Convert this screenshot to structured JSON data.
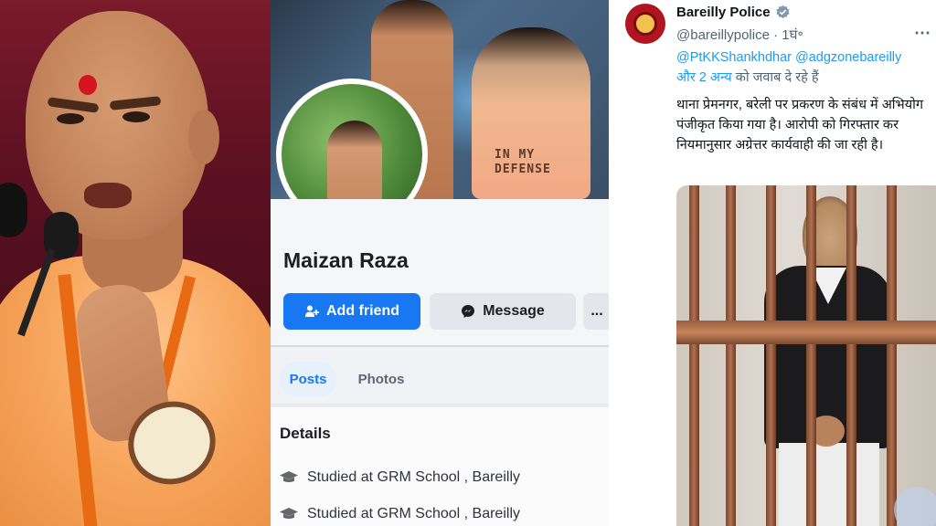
{
  "facebook": {
    "profile_name": "Maizan Raza",
    "cover_shirt_text": "IN MY DEFENSE",
    "add_friend_label": "Add friend",
    "message_label": "Message",
    "more_label": "...",
    "tabs": [
      {
        "label": "Posts",
        "active": true
      },
      {
        "label": "Photos",
        "active": false
      }
    ],
    "details_title": "Details",
    "details": [
      {
        "icon": "graduation-cap-icon",
        "text": "Studied at GRM School , Bareilly"
      },
      {
        "icon": "graduation-cap-icon",
        "text": "Studied at GRM School , Bareilly"
      }
    ],
    "colors": {
      "primary_button": "#1877f2",
      "secondary_button": "#e4e6eb"
    }
  },
  "tweet": {
    "author_name": "Bareilly Police",
    "verified": true,
    "handle_line": "@bareillypolice · 1घं॰",
    "reply_mentions": "@PtKKShankhdhar @adgzonebareilly",
    "reply_more": "और 2 अन्य",
    "reply_suffix": "को जवाब दे रहे हैं",
    "body": "थाना प्रेमनगर, बरेली पर प्रकरण के संबंध में अभियोग पंजीकृत किया गया है। आरोपी को गिरफ्तार कर नियमानुसार अग्रेत्तर कार्यवाही की जा रही है।",
    "more_icon": "ellipsis-icon",
    "colors": {
      "link": "#1d9bf0",
      "secondary_text": "#536471",
      "text": "#0f1419"
    }
  }
}
